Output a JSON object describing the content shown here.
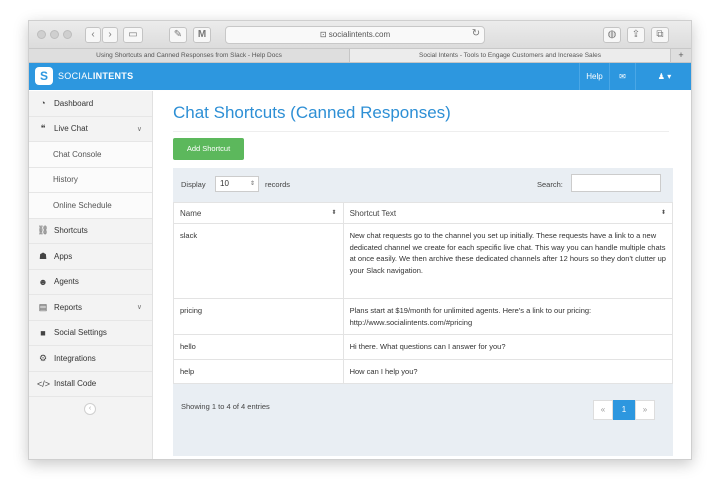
{
  "browser": {
    "url": "socialintents.com",
    "tabs": [
      "Using Shortcuts and Canned Responses from Slack - Help Docs",
      "Social Intents - Tools to Engage Customers and Increase Sales"
    ],
    "plus": "+"
  },
  "header": {
    "logo_glyph": "S",
    "brand_light": "SOCIAL",
    "brand_bold": "INTENTS",
    "help_label": "Help",
    "mail_icon": "envelope-icon",
    "user_icon": "user-icon"
  },
  "sidebar": {
    "items": [
      {
        "label": "Dashboard",
        "icon": "dashboard-icon"
      },
      {
        "label": "Live Chat",
        "icon": "chat-icon"
      },
      {
        "label": "Chat Console"
      },
      {
        "label": "History"
      },
      {
        "label": "Online Schedule"
      },
      {
        "label": "Shortcuts",
        "icon": "link-icon"
      },
      {
        "label": "Apps",
        "icon": "apps-icon"
      },
      {
        "label": "Agents",
        "icon": "agents-icon"
      },
      {
        "label": "Reports",
        "icon": "reports-icon"
      },
      {
        "label": "Social Settings",
        "icon": "facebook-icon"
      },
      {
        "label": "Integrations",
        "icon": "cogs-icon"
      },
      {
        "label": "Install Code",
        "icon": "code-icon"
      }
    ],
    "collapse_glyph": "‹"
  },
  "main": {
    "title": "Chat Shortcuts (Canned Responses)",
    "add_button": "Add Shortcut",
    "display_label": "Display",
    "display_value": "10",
    "records_label": "records",
    "search_label": "Search:",
    "search_value": "",
    "columns": [
      "Name",
      "Shortcut Text"
    ],
    "rows": [
      {
        "name": "slack",
        "text": "New chat requests go to the channel you set up initially. These requests have a link to a new dedicated channel we create for each specific live chat. This way you can handle multiple chats at once easily. We then archive these dedicated channels after 12 hours so they don't clutter up your Slack navigation."
      },
      {
        "name": "pricing",
        "text": "Plans start at $19/month for unlimited agents. Here's a link to our pricing: http://www.socialintents.com/#pricing"
      },
      {
        "name": "hello",
        "text": "Hi there. What questions can I answer for you?"
      },
      {
        "name": "help",
        "text": "How can I help you?"
      }
    ],
    "showing": "Showing 1 to 4 of 4 entries",
    "pager": {
      "prev": "«",
      "page": "1",
      "next": "»"
    }
  },
  "colors": {
    "accent": "#2d97df",
    "title": "#2d8fd5",
    "add_button": "#5cb85c"
  }
}
